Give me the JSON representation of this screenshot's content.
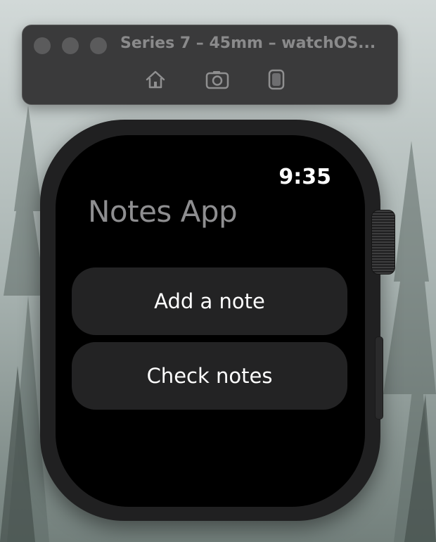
{
  "simulator": {
    "title": "Series 7 – 45mm – watchOS...",
    "toolbar_icons": [
      "home-icon",
      "screenshot-icon",
      "rotate-icon"
    ]
  },
  "watch": {
    "time": "9:35",
    "app_title": "Notes App",
    "buttons": [
      {
        "label": "Add a note"
      },
      {
        "label": "Check notes"
      }
    ]
  },
  "colors": {
    "screen_background": "#000000",
    "button_background": "#232324",
    "title_text": "#8e8e90",
    "button_text": "#ffffff"
  }
}
